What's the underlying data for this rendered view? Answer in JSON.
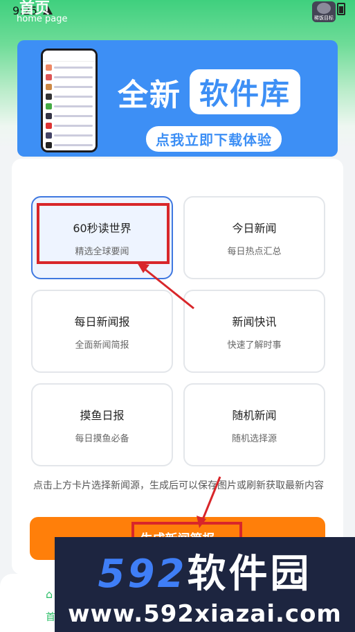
{
  "status": {
    "time": "9:25",
    "brand_tag": "稀饭目标"
  },
  "header": {
    "title": "首页",
    "subtitle": "home page"
  },
  "banner": {
    "title_part1": "全新",
    "title_part2": "软件库",
    "cta": "点我立即下载体验"
  },
  "cards": [
    {
      "title": "60秒读世界",
      "subtitle": "精选全球要闻",
      "selected": true
    },
    {
      "title": "今日新闻",
      "subtitle": "每日热点汇总",
      "selected": false
    },
    {
      "title": "每日新闻报",
      "subtitle": "全面新闻简报",
      "selected": false
    },
    {
      "title": "新闻快讯",
      "subtitle": "快速了解时事",
      "selected": false
    },
    {
      "title": "摸鱼日报",
      "subtitle": "每日摸鱼必备",
      "selected": false
    },
    {
      "title": "随机新闻",
      "subtitle": "随机选择源",
      "selected": false
    }
  ],
  "hint": "点击上方卡片选择新闻源，生成后可以保存图片或刷新获取最新内容",
  "generate_button": "生成新闻简报",
  "nav": {
    "home_label": "首页"
  },
  "watermark": {
    "number": "592",
    "name": "软件园",
    "url": "www.592xiazai.com"
  },
  "colors": {
    "accent": "#3d8ff5",
    "button": "#ff7f0a",
    "highlight": "#d8262a",
    "selected_border": "#3f78e0"
  }
}
